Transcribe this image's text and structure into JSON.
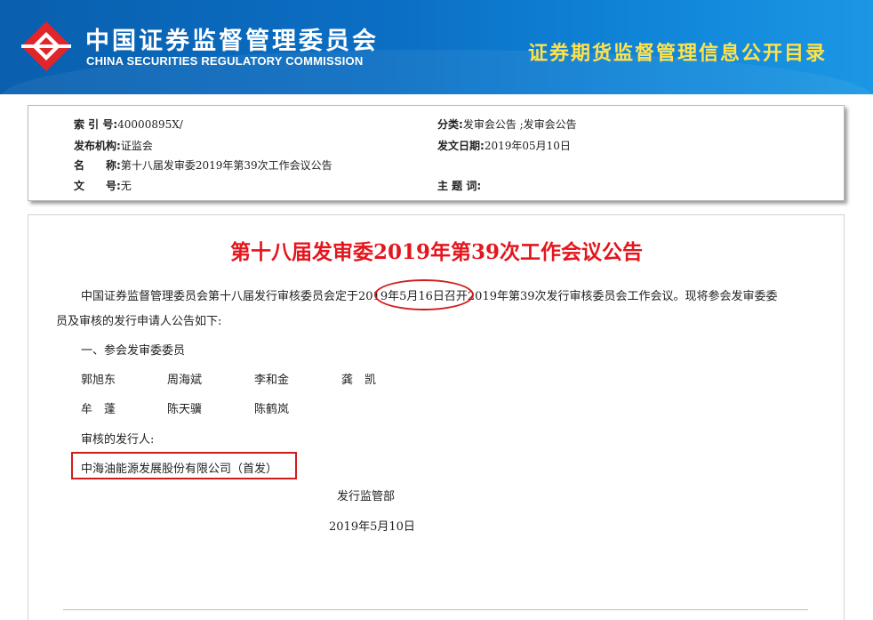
{
  "header": {
    "org_cn": "中国证券监督管理委员会",
    "org_en": "CHINA SECURITIES REGULATORY COMMISSION",
    "directory_title": "证券期货监督管理信息公开目录",
    "colors": {
      "banner": "#0b6fc4",
      "directory_title": "#ffe24a",
      "logo": "#e0262a"
    }
  },
  "meta": {
    "index_label": "索 引 号:",
    "index_value": "40000895X/",
    "category_label": "分类:",
    "category_value": "发审会公告 ;发审会公告",
    "issuer_label": "发布机构:",
    "issuer_value": "证监会",
    "date_label": "发文日期:",
    "date_value": "2019年05月10日",
    "name_label": "名　　称:",
    "name_value": "第十八届发审委2019年第39次工作会议公告",
    "docno_label": "文　　号:",
    "docno_value": "无",
    "keywords_label": "主 题 词:",
    "keywords_value": ""
  },
  "article": {
    "title": "第十八届发审委2019年第39次工作会议公告",
    "para1_line1": "中国证券监督管理委员会第十八届发行审核委员会定于2019年5月16日召开2019年第39次发行审核委员会工作会议。现将参会发审委委",
    "para1_line2": "员及审核的发行申请人公告如下:",
    "section1": "一、参会发审委委员",
    "members": [
      "郭旭东",
      "周海斌",
      "李和金",
      "龚　凯",
      "牟　蓬",
      "陈天骥",
      "陈鹤岚"
    ],
    "reviewed_label": "审核的发行人:",
    "issuer_name": "中海油能源发展股份有限公司（首发）",
    "department": "发行监管部",
    "sign_date": "2019年5月10日",
    "colors": {
      "title": "#e4161d",
      "highlight": "#d21b1b"
    }
  }
}
